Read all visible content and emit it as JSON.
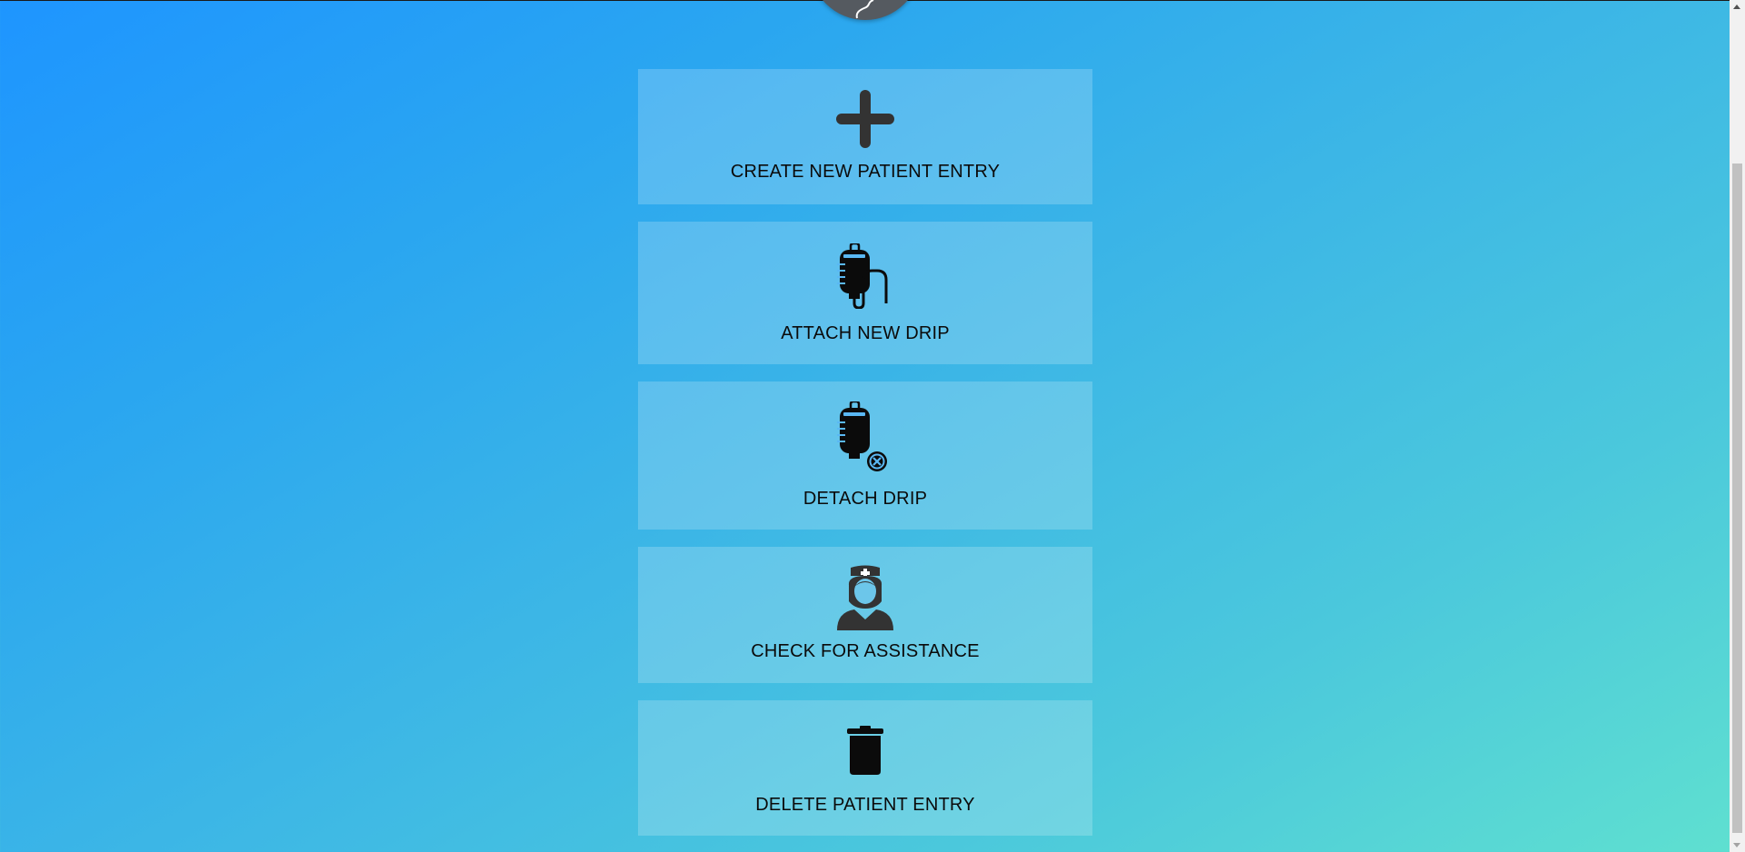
{
  "logo": {
    "icon": "drip-tube-logo-icon"
  },
  "actions": [
    {
      "label": "CREATE NEW PATIENT ENTRY",
      "icon": "plus-icon"
    },
    {
      "label": "ATTACH NEW DRIP",
      "icon": "iv-drip-attach-icon"
    },
    {
      "label": "DETACH DRIP",
      "icon": "iv-drip-detach-icon"
    },
    {
      "label": "CHECK FOR ASSISTANCE",
      "icon": "nurse-icon"
    },
    {
      "label": "DELETE PATIENT ENTRY",
      "icon": "trash-icon"
    }
  ],
  "colors": {
    "gradient_start": "#1e95ff",
    "gradient_end": "#5fe0d0",
    "icon": "#333333",
    "text": "#0b0b0b"
  }
}
